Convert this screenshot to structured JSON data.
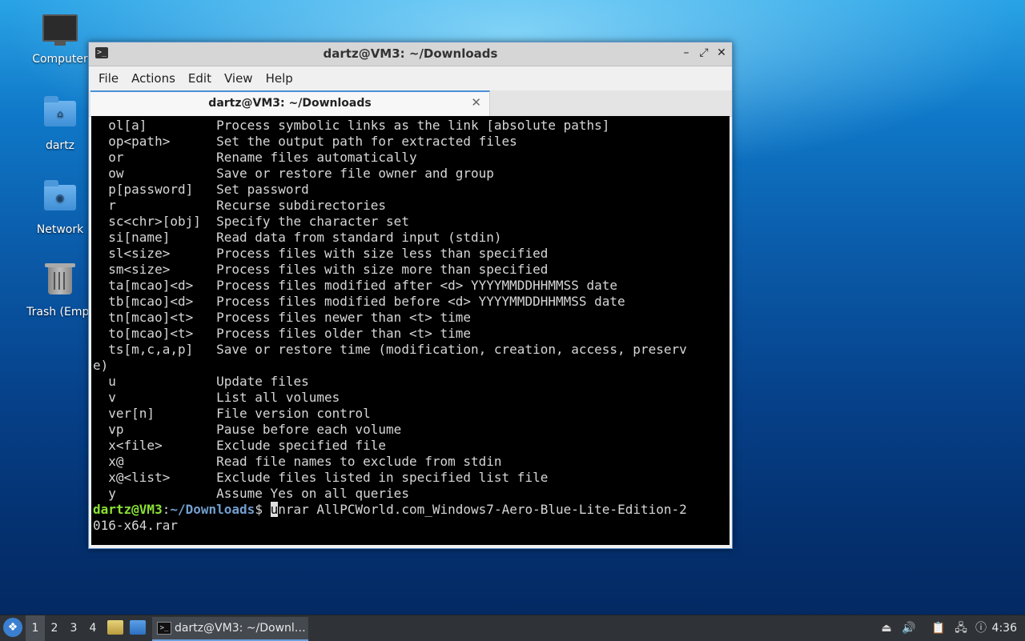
{
  "desktop": {
    "icons": [
      {
        "label": "Computer",
        "icon": "computer-icon"
      },
      {
        "label": "dartz",
        "icon": "home-folder-icon"
      },
      {
        "label": "Network",
        "icon": "network-folder-icon"
      },
      {
        "label": "Trash (Empt",
        "icon": "trash-icon"
      }
    ]
  },
  "window": {
    "title": "dartz@VM3: ~/Downloads",
    "controls": {
      "minimize": "–",
      "maximize": "⤢",
      "close": "✕"
    },
    "menu": [
      "File",
      "Actions",
      "Edit",
      "View",
      "Help"
    ],
    "tab": {
      "label": "dartz@VM3: ~/Downloads",
      "close": "✕"
    }
  },
  "terminal": {
    "lines": [
      "  ol[a]         Process symbolic links as the link [absolute paths]",
      "  op<path>      Set the output path for extracted files",
      "  or            Rename files automatically",
      "  ow            Save or restore file owner and group",
      "  p[password]   Set password",
      "  r             Recurse subdirectories",
      "  sc<chr>[obj]  Specify the character set",
      "  si[name]      Read data from standard input (stdin)",
      "  sl<size>      Process files with size less than specified",
      "  sm<size>      Process files with size more than specified",
      "  ta[mcao]<d>   Process files modified after <d> YYYYMMDDHHMMSS date",
      "  tb[mcao]<d>   Process files modified before <d> YYYYMMDDHHMMSS date",
      "  tn[mcao]<t>   Process files newer than <t> time",
      "  to[mcao]<t>   Process files older than <t> time",
      "  ts[m,c,a,p]   Save or restore time (modification, creation, access, preserv",
      "e)",
      "  u             Update files",
      "  v             List all volumes",
      "  ver[n]        File version control",
      "  vp            Pause before each volume",
      "  x<file>       Exclude specified file",
      "  x@            Read file names to exclude from stdin",
      "  x@<list>      Exclude files listed in specified list file",
      "  y             Assume Yes on all queries"
    ],
    "prompt": {
      "user_host": "dartz@VM3",
      "sep": ":",
      "path": "~/Downloads",
      "symbol": "$ ",
      "cursor_char": "u",
      "command_rest": "nrar AllPCWorld.com_Windows7-Aero-Blue-Lite-Edition-2",
      "wrap": "016-x64.rar"
    }
  },
  "taskbar": {
    "start_icon": "menu-icon",
    "workspaces": [
      "1",
      "2",
      "3",
      "4"
    ],
    "active_workspace": "1",
    "task_label": "dartz@VM3: ~/Downl…",
    "tray_icons": [
      "eject-icon",
      "volume-icon",
      "clipboard-icon",
      "network-icon",
      "notification-icon"
    ],
    "clock": "4:36"
  }
}
